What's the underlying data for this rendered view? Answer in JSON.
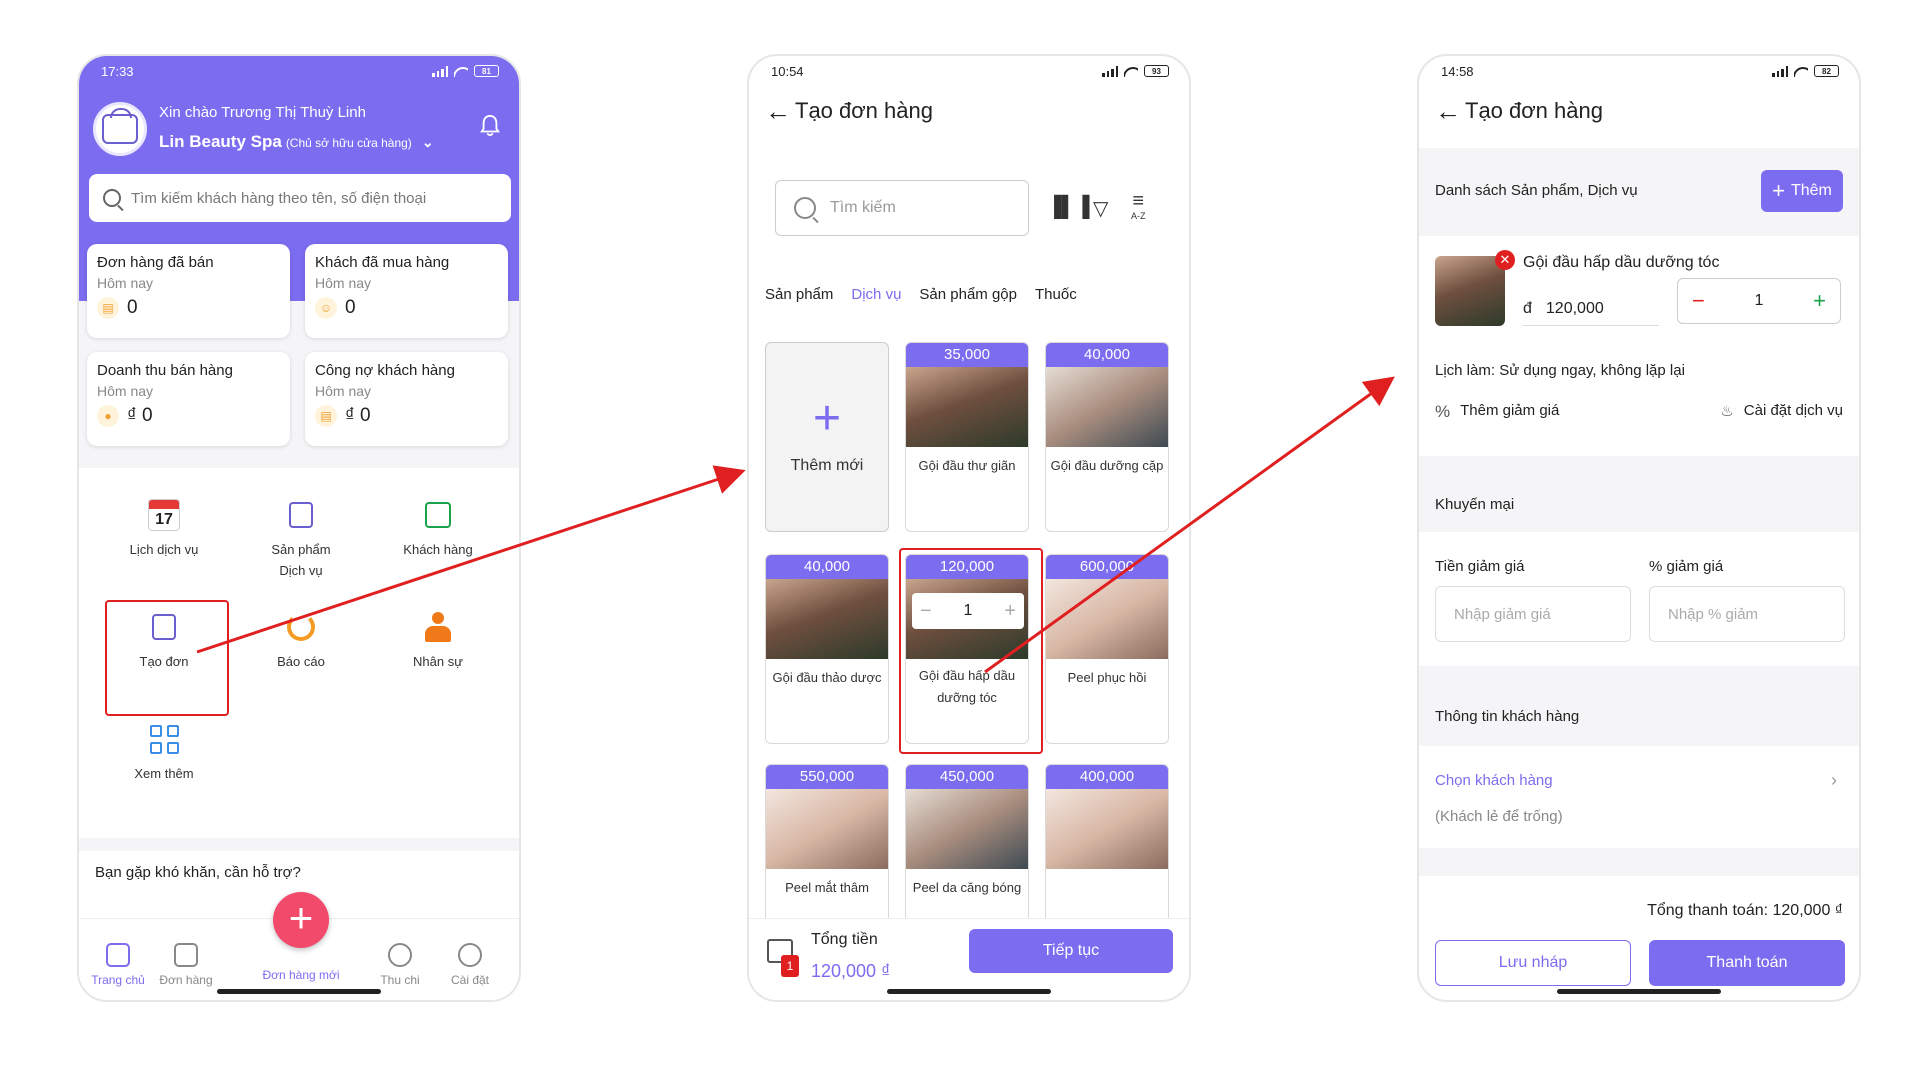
{
  "screen1": {
    "status_time": "17:33",
    "battery": "81",
    "greeting": "Xin chào Trương Thị Thuỳ Linh",
    "shop_name": "Lin Beauty Spa",
    "shop_role": "(Chủ sở hữu cửa hàng)",
    "search_placeholder": "Tìm kiếm khách hàng theo tên, số điện thoại",
    "stats": [
      {
        "title": "Đơn hàng đã bán",
        "sub": "Hôm nay",
        "value": "0"
      },
      {
        "title": "Khách đã mua hàng",
        "sub": "Hôm nay",
        "value": "0"
      },
      {
        "title": "Doanh thu bán hàng",
        "sub": "Hôm nay",
        "value": "₫ 0"
      },
      {
        "title": "Công nợ khách hàng",
        "sub": "Hôm nay",
        "value": "₫ 0"
      }
    ],
    "calendar_day": "17",
    "menu": {
      "schedule": "Lịch dịch vụ",
      "products_line1": "Sản phẩm",
      "products_line2": "Dịch vụ",
      "customers": "Khách hàng",
      "create_order": "Tạo đơn",
      "report": "Báo cáo",
      "staff": "Nhân sự",
      "more": "Xem thêm"
    },
    "help_text": "Bạn gặp khó khăn, cần hỗ trợ?",
    "tabs": {
      "home": "Trang chủ",
      "orders": "Đơn hàng",
      "new_order": "Đơn hàng mới",
      "income": "Thu chi",
      "settings": "Cài đặt"
    }
  },
  "screen2": {
    "status_time": "10:54",
    "battery": "93",
    "title": "Tạo đơn hàng",
    "search_placeholder": "Tìm kiếm",
    "sort_label": "A-Z",
    "categories": [
      "Sản phẩm",
      "Dịch vụ",
      "Sản phẩm gộp",
      "Thuốc"
    ],
    "active_category": "Dịch vụ",
    "new_card_label": "Thêm mới",
    "services": [
      {
        "price": "35,000",
        "name": "Gội đầu thư giãn"
      },
      {
        "price": "40,000",
        "name": "Gội đầu dưỡng cặp"
      },
      {
        "price": "40,000",
        "name": "Gội đầu thảo dược"
      },
      {
        "price": "120,000",
        "name": "Gội đầu hấp dầu dưỡng tóc"
      },
      {
        "price": "600,000",
        "name": "Peel phục hồi"
      },
      {
        "price": "550,000",
        "name": "Peel mắt thâm"
      },
      {
        "price": "450,000",
        "name": "Peel da căng bóng"
      },
      {
        "price": "400,000",
        "name": ""
      }
    ],
    "selected_qty": "1",
    "cart_count": "1",
    "total_label": "Tổng tiền",
    "total_value": "120,000 ₫",
    "continue_button": "Tiếp tục"
  },
  "screen3": {
    "status_time": "14:58",
    "battery": "82",
    "title": "Tạo đơn hàng",
    "list_title": "Danh sách Sản phẩm, Dịch vụ",
    "add_button": "Thêm",
    "item": {
      "name": "Gội đầu hấp dầu dưỡng tóc",
      "currency": "đ",
      "price": "120,000",
      "qty": "1"
    },
    "schedule_text": "Lịch làm: Sử dụng ngay, không lặp lại",
    "add_discount": "Thêm giảm giá",
    "service_settings": "Cài đặt dịch vụ",
    "promotion_title": "Khuyến mại",
    "discount_amount_label": "Tiền giảm giá",
    "discount_percent_label": "% giảm giá",
    "discount_amount_placeholder": "Nhập giảm giá",
    "discount_percent_placeholder": "Nhập % giảm",
    "customer_info_title": "Thông tin khách hàng",
    "choose_customer": "Chọn khách hàng",
    "walkin_hint": "(Khách lẻ để trống)",
    "total_text": "Tổng thanh toán: 120,000 ₫",
    "save_draft": "Lưu nháp",
    "pay": "Thanh toán"
  },
  "colors": {
    "primary": "#7b6cf0",
    "accent_fab": "#f24a6b",
    "annotation_red": "#e02020"
  }
}
